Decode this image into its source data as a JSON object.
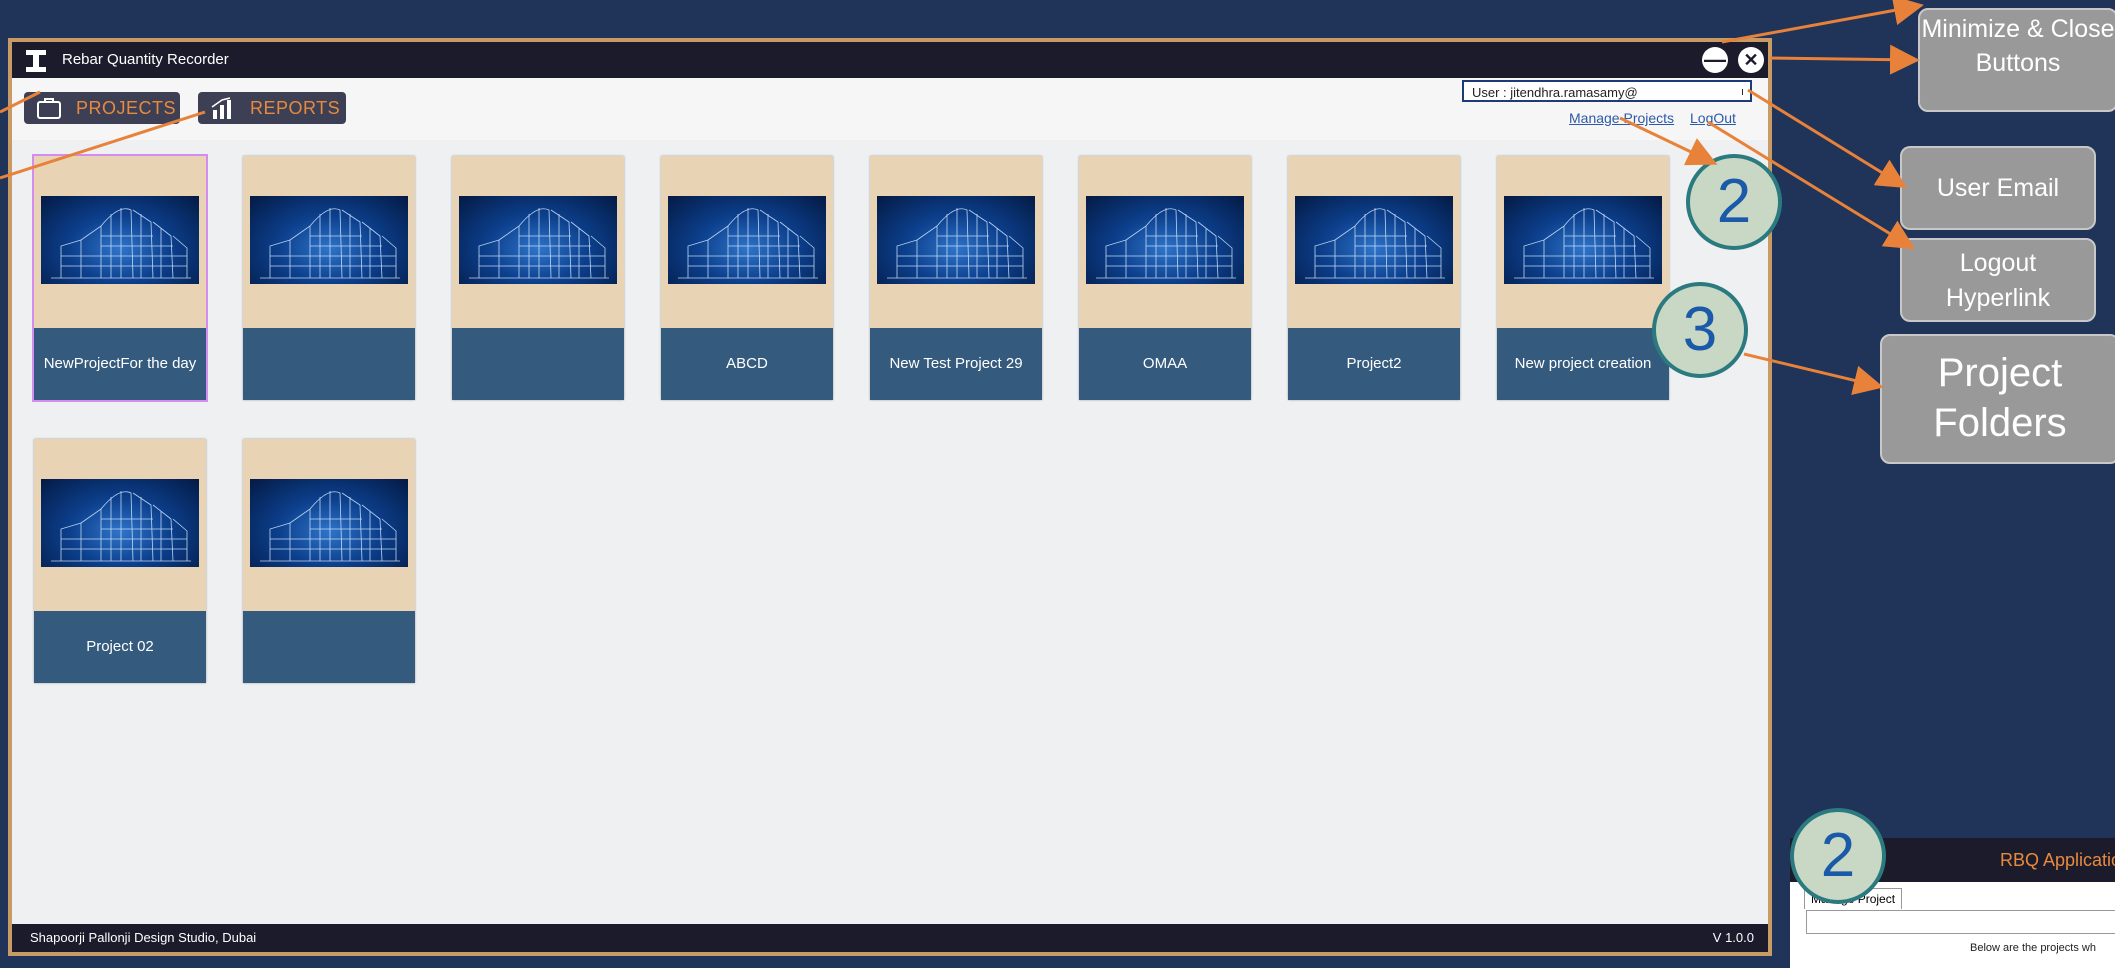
{
  "window": {
    "title": "Rebar Quantity Recorder",
    "minimize_glyph": "—",
    "close_glyph": "✕"
  },
  "toolbar": {
    "projects_label": "PROJECTS",
    "reports_label": "REPORTS"
  },
  "user": {
    "label": "User : jitendhra.ramasamy@",
    "caret": "ı"
  },
  "links": {
    "manage_projects": "Manage Projects",
    "logout": "LogOut"
  },
  "projects": [
    {
      "name": "NewProjectFor the day"
    },
    {
      "name": ""
    },
    {
      "name": ""
    },
    {
      "name": "ABCD"
    },
    {
      "name": "New Test Project 29"
    },
    {
      "name": "OMAA"
    },
    {
      "name": "Project2"
    },
    {
      "name": "New project creation"
    },
    {
      "name": "Project 02"
    },
    {
      "name": ""
    }
  ],
  "statusbar": {
    "company": "Shapoorji Pallonji Design Studio, Dubai",
    "version": "V 1.0.0"
  },
  "callouts": {
    "min_close": "Minimize & Close Buttons",
    "user_email": "User Email",
    "logout": "Logout Hyperlink",
    "folders": "Project Folders"
  },
  "markers": {
    "two": "2",
    "three": "3",
    "two_bottom": "2"
  },
  "rbq_panel": {
    "title": "RBQ Applicatio",
    "tab": "Manage Project",
    "note": "Below are the projects wh"
  },
  "colors": {
    "accent": "#e88a3e",
    "frame": "#c89b66",
    "card_label": "#345a7e",
    "background": "#1f3458"
  }
}
